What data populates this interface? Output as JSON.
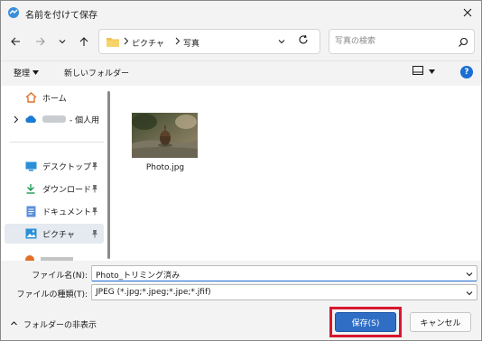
{
  "window": {
    "title": "名前を付けて保存"
  },
  "nav": {
    "breadcrumb": [
      "ピクチャ",
      "写真"
    ]
  },
  "search": {
    "placeholder": "写真の検索"
  },
  "toolbar": {
    "organize_label": "整理",
    "new_folder_label": "新しいフォルダー"
  },
  "sidebar": {
    "items": [
      {
        "label": "ホーム",
        "icon": "home-icon"
      },
      {
        "label": "- 個人用",
        "icon": "cloud-icon",
        "expandable": true
      },
      {
        "label": "デスクトップ",
        "icon": "desktop-icon",
        "pinned": true
      },
      {
        "label": "ダウンロード",
        "icon": "download-icon",
        "pinned": true
      },
      {
        "label": "ドキュメント",
        "icon": "document-icon",
        "pinned": true
      },
      {
        "label": "ピクチャ",
        "icon": "pictures-icon",
        "pinned": true,
        "selected": true
      }
    ]
  },
  "files": [
    {
      "name": "Photo.jpg",
      "icon": "photo-thumbnail"
    }
  ],
  "form": {
    "filename_label": "ファイル名(N):",
    "filename_value": "Photo_トリミング済み",
    "filetype_label": "ファイルの種類(T):",
    "filetype_value": "JPEG (*.jpg;*.jpeg;*.jpe;*.jfif)"
  },
  "footer": {
    "hide_folders_label": "フォルダーの非表示",
    "save_label": "保存(S)",
    "cancel_label": "キャンセル"
  },
  "colors": {
    "accent": "#2f6ec4",
    "highlight": "#d8172f",
    "help": "#1b6ed3"
  }
}
